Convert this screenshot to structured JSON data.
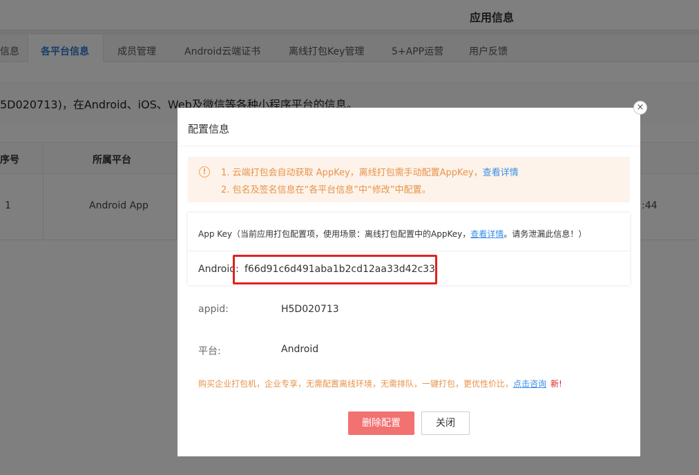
{
  "page": {
    "title": "应用信息",
    "tabs": [
      "信息",
      "各平台信息",
      "成员管理",
      "Android云端证书",
      "离线打包Key管理",
      "5+APP运营",
      "用户反馈"
    ],
    "active_tab": "各平台信息",
    "description": "5D020713)，在Android、iOS、Web及微信等各种小程序平台的信息。",
    "table": {
      "headers": [
        "序号",
        "所属平台"
      ],
      "row": {
        "index": "1",
        "platform": "Android App",
        "trailing": ":44"
      }
    }
  },
  "modal": {
    "title": "配置信息",
    "close_icon": "×",
    "notice": {
      "icon": "!",
      "line1": "1. 云端打包会自动获取 AppKey，离线打包需手动配置AppKey，",
      "line1_link": "查看详情",
      "line2": "2. 包名及签名信息在“各平台信息”中“修改”中配置。"
    },
    "appkey": {
      "title_prefix": "App Key（当前应用打包配置项，使用场景：离线打包配置中的AppKey，",
      "title_link": "查看详情",
      "title_suffix": "。请务泄漏此信息！）",
      "android_label": "Android:",
      "android_key": "f66d91c6d491aba1b2cd12aa33d42c33"
    },
    "fields": [
      {
        "label": "appid:",
        "value": "H5D020713"
      },
      {
        "label": "平台:",
        "value": "Android"
      }
    ],
    "promo": {
      "text": "购买企业打包机，企业专享，无需配置离线环境，无需排队，一键打包，更优性价比，",
      "link": "点击咨询",
      "badge": "新!"
    },
    "buttons": {
      "delete": "删除配置",
      "close": "关闭"
    }
  },
  "colors": {
    "accent": "#2f7ad4",
    "warning_text": "#e8924a",
    "danger_button": "#f27171",
    "highlight_border": "#e02020"
  }
}
